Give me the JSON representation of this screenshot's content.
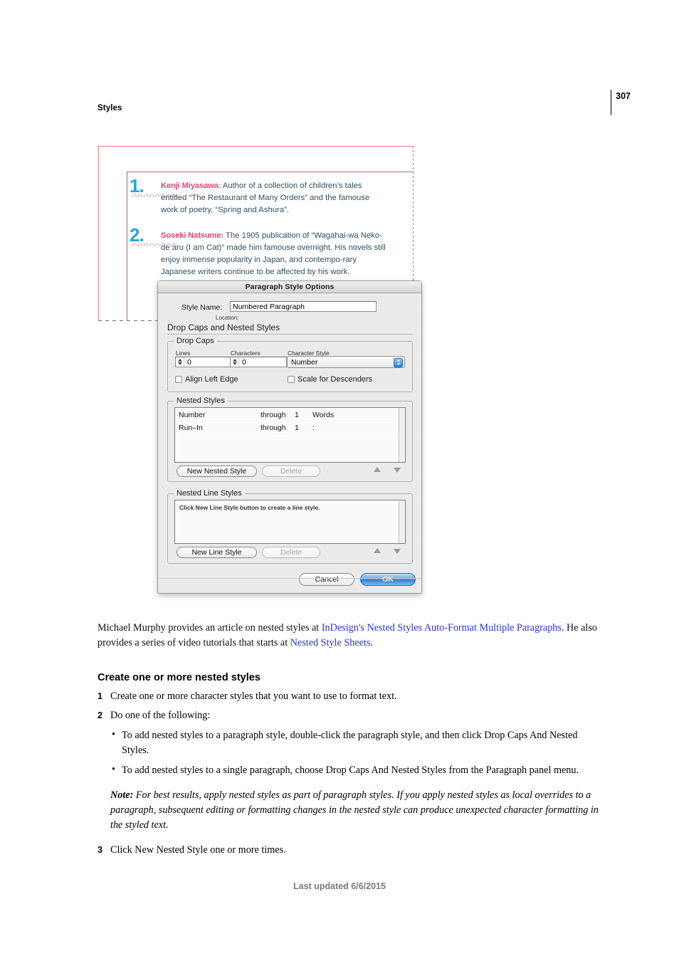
{
  "header": {
    "section": "Styles",
    "page_number": "307"
  },
  "figure": {
    "list": [
      {
        "number": "1.",
        "name": "Kenji Miyasawa:",
        "text": " Author of a collection of children’s tales entitled “The Restaurant of Many Orders” and the famouse work of poetry, “Spring and Ashura”."
      },
      {
        "number": "2.",
        "name": "Soseki Natsume:",
        "text": " The 1905 publication of “Wagahai-wa Neko-de aru (I am Cat)” made him famouse overnight. His novels still enjoy immense popularity in Japan, and contempo-rary Japanese writers continue to be affected by his work."
      }
    ]
  },
  "dialog": {
    "title": "Paragraph Style Options",
    "style_name_label": "Style Name:",
    "style_name_value": "Numbered Paragraph",
    "location_label": "Location:",
    "section_title": "Drop Caps and Nested Styles",
    "drop_caps": {
      "group_label": "Drop Caps",
      "lines_label": "Lines",
      "lines_value": "0",
      "characters_label": "Characters",
      "characters_value": "0",
      "character_style_label": "Character Style",
      "character_style_value": "Number",
      "align_left_edge_label": "Align Left Edge",
      "scale_for_descenders_label": "Scale for Descenders"
    },
    "nested_styles": {
      "group_label": "Nested Styles",
      "rows": [
        {
          "style": "Number",
          "through": "through",
          "count": "1",
          "target": "Words"
        },
        {
          "style": "Run–In",
          "through": "through",
          "count": "1",
          "target": ":"
        }
      ],
      "new_button": "New Nested Style",
      "delete_button": "Delete"
    },
    "nested_line_styles": {
      "group_label": "Nested Line Styles",
      "placeholder": "Click New Line Style button to create a line style.",
      "new_button": "New Line Style",
      "delete_button": "Delete"
    },
    "cancel_button": "Cancel",
    "ok_button": "OK"
  },
  "body": {
    "intro_1": "Michael Murphy provides an article on nested styles at ",
    "link_1": "InDesign's Nested Styles Auto-Format Multiple Paragraphs",
    "intro_2": ". He also provides a series of video tutorials that starts at ",
    "link_2": "Nested Style Sheets",
    "intro_3": ".",
    "heading": "Create one or more nested styles",
    "step_1_num": "1",
    "step_1": "Create one or more character styles that you want to use to format text.",
    "step_2_num": "2",
    "step_2": "Do one of the following:",
    "bullet_dot": "•",
    "bullet_1": "To add nested styles to a paragraph style, double-click the paragraph style, and then click Drop Caps And Nested Styles.",
    "bullet_2": "To add nested styles to a single paragraph, choose Drop Caps And Nested Styles from the Paragraph panel menu.",
    "note_label": "Note:",
    "note_text": " For best results, apply nested styles as part of paragraph styles. If you apply nested styles as local overrides to a paragraph, subsequent editing or formatting changes in the nested style can produce unexpected character formatting in the styled text.",
    "step_3_num": "3",
    "step_3": "Click New Nested Style one or more times."
  },
  "footer": {
    "text": "Last updated 6/6/2015"
  }
}
